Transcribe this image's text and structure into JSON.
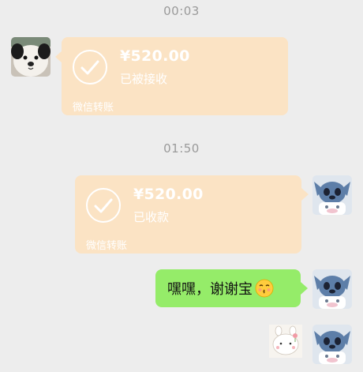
{
  "chat": {
    "time1": "00:03",
    "time2": "01:50",
    "msg1": {
      "amount": "¥520.00",
      "status": "已被接收",
      "footer": "微信转账"
    },
    "msg2": {
      "amount": "¥520.00",
      "status": "已收款",
      "footer": "微信转账"
    },
    "msg3": {
      "text": "嘿嘿，谢谢宝",
      "emoji": "kissing-face-emoji"
    }
  },
  "icons": {
    "contact_avatar": "puppy-avatar",
    "self_avatar": "stitch-avatar",
    "sticker": "bunny-sticker",
    "check": "check-circle-icon"
  },
  "colors": {
    "background": "#ededed",
    "transfer_bubble": "#fbe3c4",
    "green_bubble": "#95ec69"
  }
}
